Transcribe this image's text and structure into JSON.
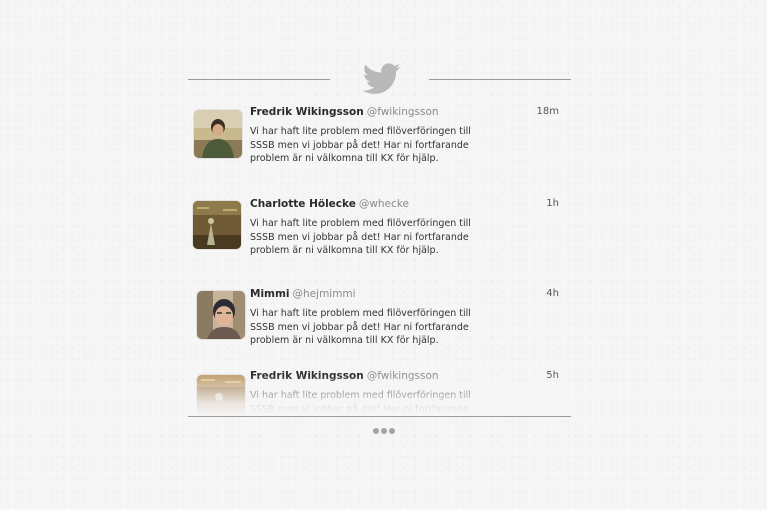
{
  "header": {
    "icon": "twitter-bird-icon",
    "icon_color": "#b9b9b9"
  },
  "tweets": [
    {
      "name": "Fredrik Wikingsson",
      "handle": "@fwikingsson",
      "time": "18m",
      "text": "Vi har haft lite problem med filöverföringen till SSSB men vi jobbar på det! Har ni fortfarande problem är ni välkomna till KX för hjälp."
    },
    {
      "name": "Charlotte Hölecke",
      "handle": "@whecke",
      "time": "1h",
      "text": "Vi har haft lite problem med filöverföringen till SSSB men vi jobbar på det! Har ni fortfarande problem är ni välkomna till KX för hjälp."
    },
    {
      "name": "Mimmi",
      "handle": "@hejmimmi",
      "time": "4h",
      "text": "Vi har haft lite problem med filöverföringen till SSSB men vi jobbar på det! Har ni fortfarande problem är ni välkomna till KX för hjälp."
    },
    {
      "name": "Fredrik Wikingsson",
      "handle": "@fwikingsson",
      "time": "5h",
      "text": "Vi har haft lite problem med filöverföringen till SSSB men vi jobbar på det! Har ni fortfarande problem är ni välkomna till KX för hjälp."
    }
  ],
  "more_button": {
    "icon": "ellipsis-icon",
    "color": "#a3a3a3"
  }
}
